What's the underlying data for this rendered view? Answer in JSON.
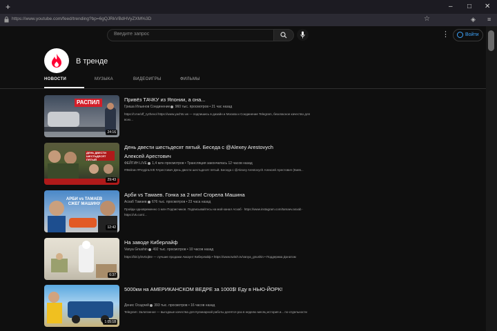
{
  "browser": {
    "new_tab": "+",
    "window_controls": {
      "minimize": "–",
      "maximize": "□",
      "close": "✕"
    },
    "url": "https://www.youtube.com/feed/trending?bp=6gQJRkVBdHVyZXM%3D"
  },
  "header": {
    "search_placeholder": "Введите запрос",
    "signin_label": "Войти"
  },
  "page": {
    "title": "В тренде",
    "tabs": [
      "НОВОСТИ",
      "МУЗЫКА",
      "ВИДЕОИГРЫ",
      "ФИЛЬМЫ"
    ],
    "active_tab": "НОВОСТИ"
  },
  "videos": [
    {
      "title": "Привёз ТАЧКУ из Японии, а она...",
      "channel": "Гриша Ильинов Соединение",
      "meta": "960 тыс. просмотров • 21 час назад",
      "desc": "https://t.me/off_ryzhevol  https://www.yachts.vw — подпишись в дизайн и Москва и Соединение Telegram, безопасное качество для всех...",
      "duration": "24:16",
      "thumb_text": "РАСПИЛ"
    },
    {
      "title": "День двести шестьдесят пятый. Беседа с @Alexey Arestovych Алексей Арестович",
      "channel": "ФЕЙГИН LIVE",
      "meta": "1,4 млн просмотров • Трансляция закончилась 12 часов назад",
      "desc": "#Фейгин #FeyginLIVE #Арестович День двести шестьдесят пятый. Беседа с @Alexey Arestovych Алексей Арестович (Киев...",
      "duration": "29:43",
      "thumb_text": "ДЕНЬ ДВЕСТИ ШЕСТЬДЕСЯТ ПЯТЫЙ"
    },
    {
      "title": "Арби vs Тамаев. Гонка за 2 млн! Сгорела Машина",
      "channel": "Асхаб Тамаев",
      "meta": "676 тыс. просмотров • 23 часа назад",
      "desc": "Пройди одновременно 1 млн Подписчиков. Подписывайтесь на мой канал Асхаб · https://www.instagram.com/tamaev.asxab · https://vk.com/...",
      "duration": "12:42",
      "thumb_text": "АРБИ vs ТАМАЕВ СЖЕГ МАШИНУ"
    },
    {
      "title": "На заводе Киберлайф",
      "channel": "Vanya Gnushin",
      "meta": "492 тыс. просмотров • 10 часов назад",
      "desc": "https://bit.ly/3vGqbte — лучшие продажи Аккаунт Киберлайф • https://www.twitch.tv/vanya_gnushin • Поддержка Донатом",
      "duration": "6:37",
      "thumb_text": ""
    },
    {
      "title": "5000км на АМЕРИКАНСКОМ ВЕДРЕ за 1000$! Еду в НЬЮ-ЙОРК!",
      "channel": "Денис Осадчий",
      "meta": "393 тыс. просмотров • 16 часов назад",
      "desc": "Telegram: Залатанное — выгодные качества для Кулинарной работы делятся раз в неделю месяц история и... по-отдельности",
      "duration": "1:05:18",
      "thumb_text": ""
    }
  ],
  "colors": {
    "accent": "#3ea6ff",
    "background": "#0f0f0f",
    "trending_red": "#ff0033"
  },
  "icons": {
    "search": "magnifier",
    "mic": "microphone",
    "trending": "flame"
  }
}
